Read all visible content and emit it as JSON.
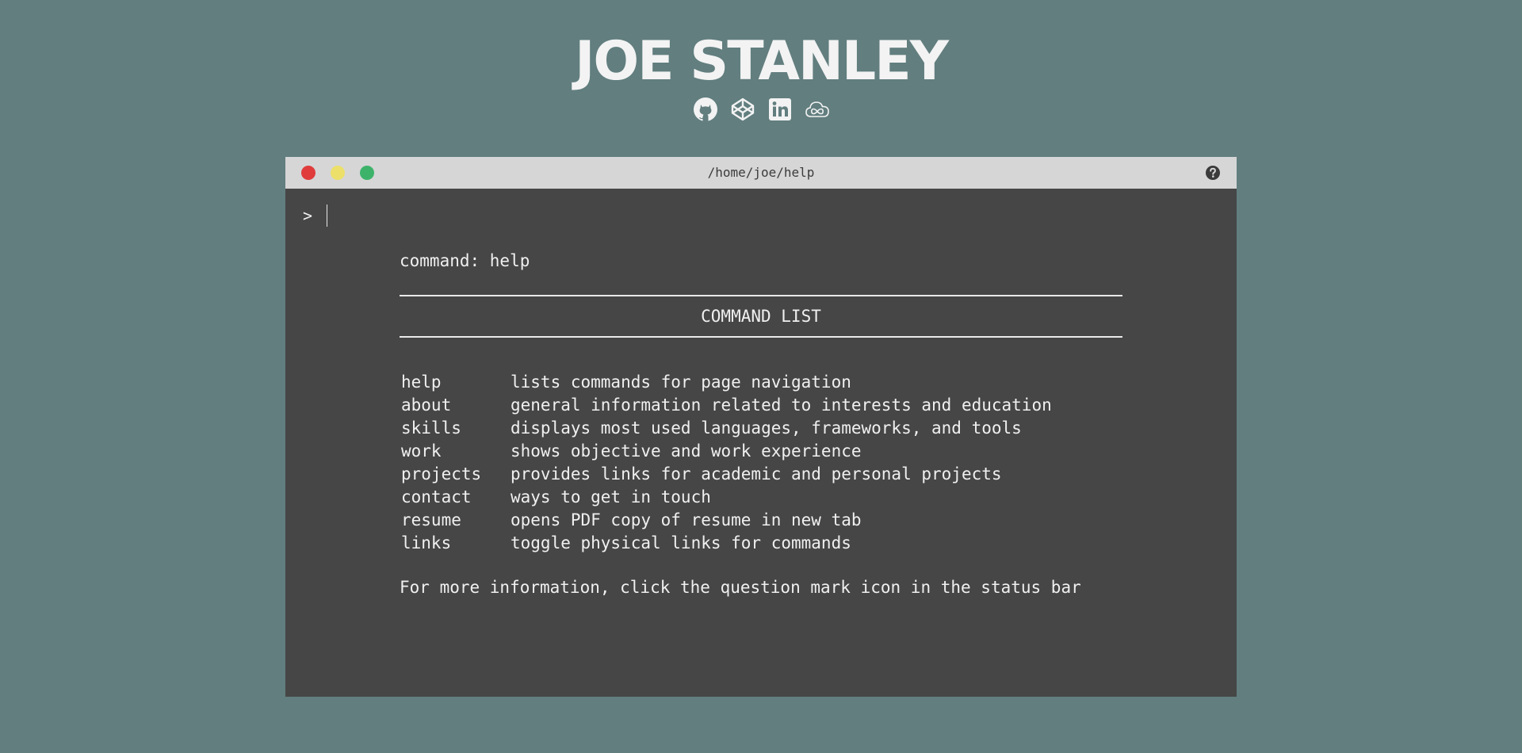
{
  "header": {
    "title": "JOE STANLEY",
    "social_links": [
      {
        "icon": "github-icon"
      },
      {
        "icon": "codepen-icon"
      },
      {
        "icon": "linkedin-icon"
      },
      {
        "icon": "cloud-infinity-icon"
      }
    ]
  },
  "terminal": {
    "path": "/home/joe/help",
    "traffic_lights": {
      "close": "#e03c3c",
      "minimize": "#ece06a",
      "maximize": "#3db36a"
    },
    "prompt": ">",
    "input_value": "",
    "command_echo": "command: help",
    "list_title": "COMMAND LIST",
    "commands": [
      {
        "name": "help",
        "description": "lists commands for page navigation"
      },
      {
        "name": "about",
        "description": "general information related to interests and education"
      },
      {
        "name": "skills",
        "description": "displays most used languages, frameworks, and tools"
      },
      {
        "name": "work",
        "description": "shows objective and work experience"
      },
      {
        "name": "projects",
        "description": "provides links for academic and personal projects"
      },
      {
        "name": "contact",
        "description": "ways to get in touch"
      },
      {
        "name": "resume",
        "description": "opens PDF copy of resume in new tab"
      },
      {
        "name": "links",
        "description": "toggle physical links for commands"
      }
    ],
    "footer_note": "For more information, click the question mark icon in the status bar"
  },
  "colors": {
    "background": "#627e7f",
    "terminal_bg": "#464646",
    "titlebar_bg": "#d6d6d6",
    "text": "#f0f0f0"
  }
}
